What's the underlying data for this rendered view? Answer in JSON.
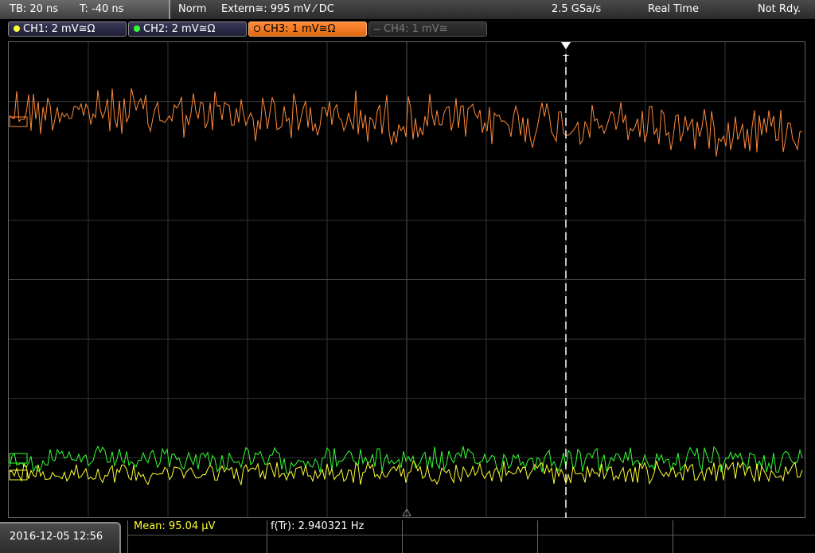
{
  "header": {
    "timebase": "TB: 20 ns",
    "trigger_time": "T: -40 ns",
    "trigger_mode": "Norm",
    "trigger_source": "Extern≅: 995 mV ⁄ DC",
    "sample_rate": "2.5 GSa/s",
    "acq_mode": "Real Time",
    "status": "Not Rdy."
  },
  "channels": [
    {
      "label": "CH1: 2 mV≅Ω",
      "color": "#ffff33",
      "state": "on"
    },
    {
      "label": "CH2: 2 mV≅Ω",
      "color": "#33ff33",
      "state": "on"
    },
    {
      "label": "CH3: 1 mV≅Ω",
      "color": "#ff8a3a",
      "state": "active"
    },
    {
      "label": "CH4: 1 mV≅",
      "color": "#888888",
      "state": "off"
    }
  ],
  "trigger_marker": "T",
  "footer": {
    "datetime": "2016-12-05 12:56",
    "measure1": "Mean: 95.04 µV",
    "measure2": "f(Tr): 2.940321 Hz"
  },
  "colors": {
    "ch1": "#ffff33",
    "ch2": "#33ff33",
    "ch3": "#ff8a3a",
    "grid": "#3a3a3a",
    "accent": "#ff8a3a"
  }
}
